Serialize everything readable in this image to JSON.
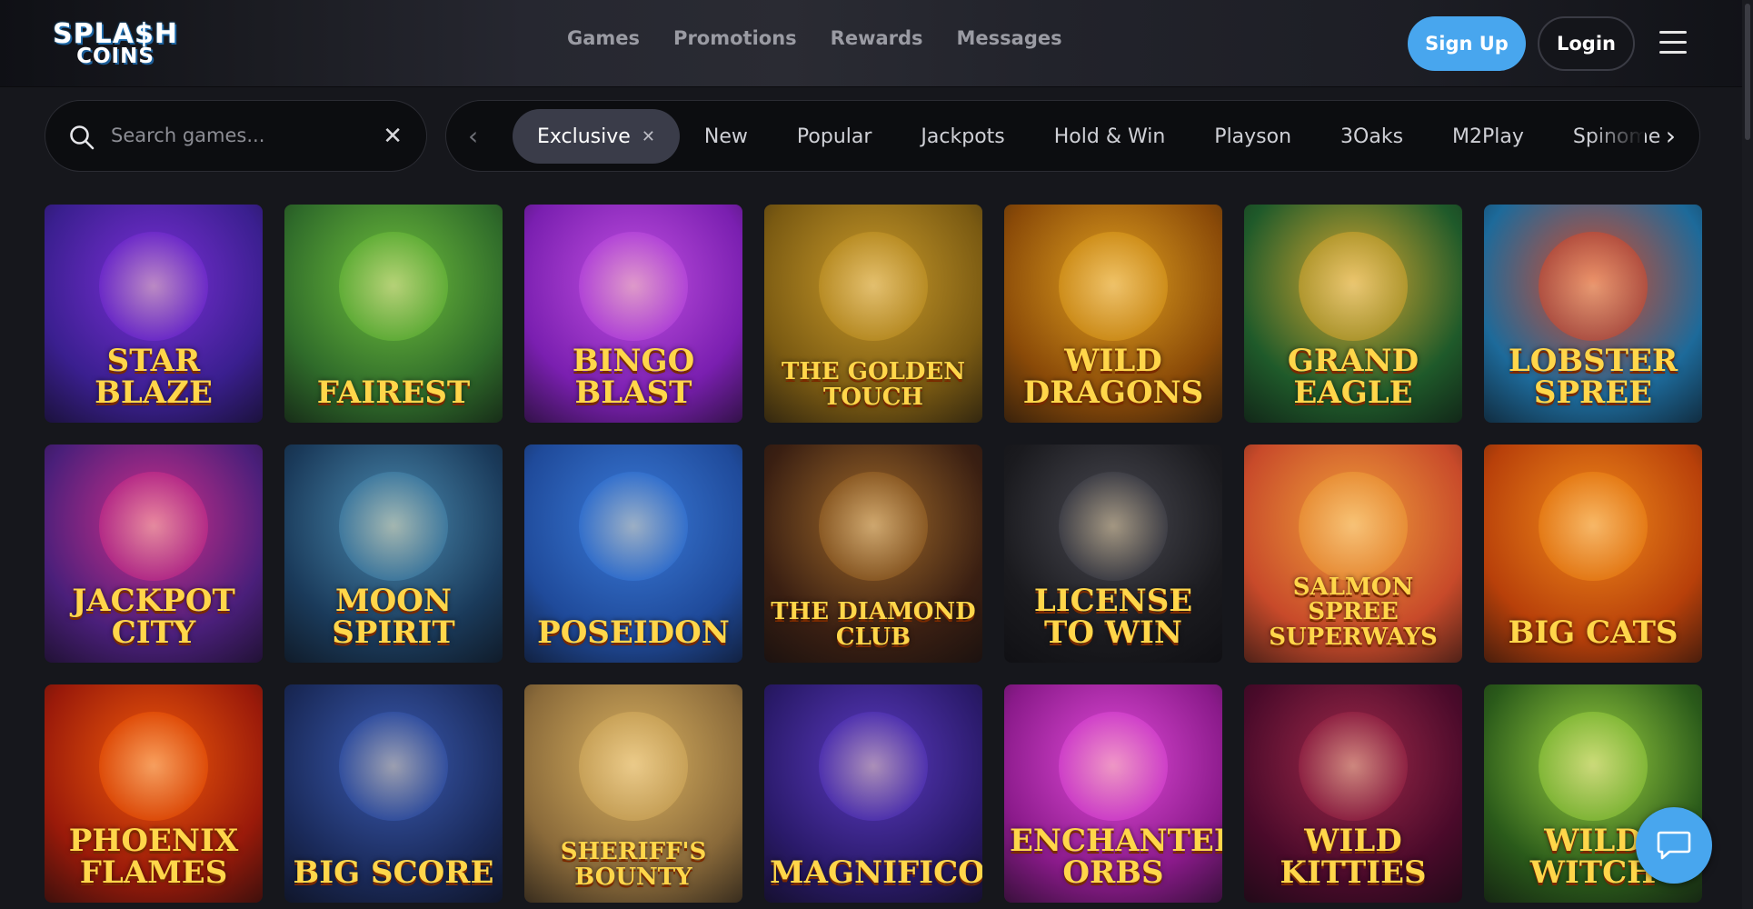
{
  "header": {
    "logo_line1": "SPLA$H",
    "logo_line2": "COINS",
    "nav": [
      "Games",
      "Promotions",
      "Rewards",
      "Messages"
    ],
    "signup_label": "Sign Up",
    "login_label": "Login"
  },
  "search": {
    "placeholder": "Search games..."
  },
  "filters": {
    "items": [
      "Exclusive",
      "New",
      "Popular",
      "Jackpots",
      "Hold & Win",
      "Playson",
      "3Oaks",
      "M2Play",
      "Spinome"
    ],
    "active": "Exclusive"
  },
  "games": [
    {
      "title": "STAR BLAZE",
      "bg": "#3a1f8f",
      "accent": "#7a2fd6"
    },
    {
      "title": "FAIREST",
      "bg": "#2f6b2a",
      "accent": "#6fbf3c"
    },
    {
      "title": "BINGO BLAST",
      "bg": "#7a1fb0",
      "accent": "#c04fe0"
    },
    {
      "title": "THE GOLDEN TOUCH",
      "bg": "#7a5a12",
      "accent": "#c99a2a"
    },
    {
      "title": "WILD DRAGONS",
      "bg": "#8a4a08",
      "accent": "#e0a020"
    },
    {
      "title": "GRAND EAGLE",
      "bg": "#1f5a2a",
      "accent": "#d8a830"
    },
    {
      "title": "LOBSTER SPREE",
      "bg": "#1d6a9a",
      "accent": "#d84a2a"
    },
    {
      "title": "JACKPOT CITY",
      "bg": "#4a1f7a",
      "accent": "#d02f8a"
    },
    {
      "title": "MOON SPIRIT",
      "bg": "#1a3a5a",
      "accent": "#4a8ab0"
    },
    {
      "title": "POSEIDON",
      "bg": "#1f4a9a",
      "accent": "#3a7ad8"
    },
    {
      "title": "THE DIAMOND CLUB",
      "bg": "#3a1f12",
      "accent": "#a06a2a"
    },
    {
      "title": "License to Win",
      "bg": "#1a1a1e",
      "accent": "#4a4a52"
    },
    {
      "title": "Salmon Spree SUPERWAYS",
      "bg": "#c84a2a",
      "accent": "#f0a03a"
    },
    {
      "title": "BIG CATS",
      "bg": "#b8400a",
      "accent": "#f08a1a"
    },
    {
      "title": "PHOENIX FLAMES",
      "bg": "#9a1a0a",
      "accent": "#f05a0a"
    },
    {
      "title": "BIG SCORE",
      "bg": "#1a2a5a",
      "accent": "#3a5ab0"
    },
    {
      "title": "SHERIFF'S BOUNTY",
      "bg": "#8a6a3a",
      "accent": "#d8b060"
    },
    {
      "title": "MAGNIFICO",
      "bg": "#2a1a6a",
      "accent": "#5a3ac0"
    },
    {
      "title": "Enchanted Orbs",
      "bg": "#8a1a8a",
      "accent": "#e04ad8"
    },
    {
      "title": "Wild Kitties",
      "bg": "#4a0a2a",
      "accent": "#a02a4a"
    },
    {
      "title": "Wild Witch",
      "bg": "#2a5a1a",
      "accent": "#9ad040"
    }
  ]
}
